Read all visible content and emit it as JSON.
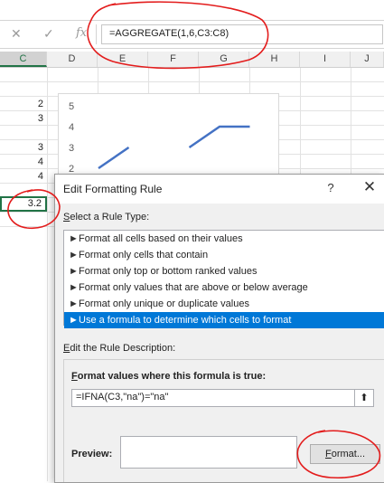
{
  "formula_bar": {
    "cancel_icon": "✕",
    "confirm_icon": "✓",
    "fx_label": "fx",
    "formula": "=AGGREGATE(1,6,C3:C8)"
  },
  "columns": {
    "C": "C",
    "D": "D",
    "E": "E",
    "F": "F",
    "G": "G",
    "H": "H",
    "I": "I",
    "J": "J"
  },
  "cells": {
    "c1": "2",
    "c2": "3",
    "c3": "3",
    "c4": "4",
    "c5": "4",
    "c_active": "3.2"
  },
  "chart_data": {
    "type": "line",
    "ytick_labels": [
      "5",
      "4",
      "3",
      "2"
    ],
    "ylim": [
      2,
      5
    ],
    "series": [
      {
        "values": [
          2,
          3,
          null,
          3,
          4,
          4
        ]
      }
    ],
    "line_color": "#4472c4"
  },
  "dialog": {
    "title": "Edit Formatting Rule",
    "help_icon": "?",
    "close_icon": "✕",
    "select_rule_type_prefix": "S",
    "select_rule_type_rest": "elect a Rule Type:",
    "rule_types": [
      "Format all cells based on their values",
      "Format only cells that contain",
      "Format only top or bottom ranked values",
      "Format only values that are above or below average",
      "Format only unique or duplicate values",
      "Use a formula to determine which cells to format"
    ],
    "rule_arrow": "►",
    "selected_index": 5,
    "edit_desc_prefix": "E",
    "edit_desc_rest": "dit the Rule Description:",
    "format_values_prefix": "F",
    "format_values_rest": "ormat values where this formula is true:",
    "formula_value": "=IFNA(C3,\"na\")=\"na\"",
    "collapse_icon": "⬆",
    "preview_label": "Preview:",
    "format_button_prefix": "F",
    "format_button_rest": "ormat..."
  },
  "annotation_color": "#e31c1c"
}
